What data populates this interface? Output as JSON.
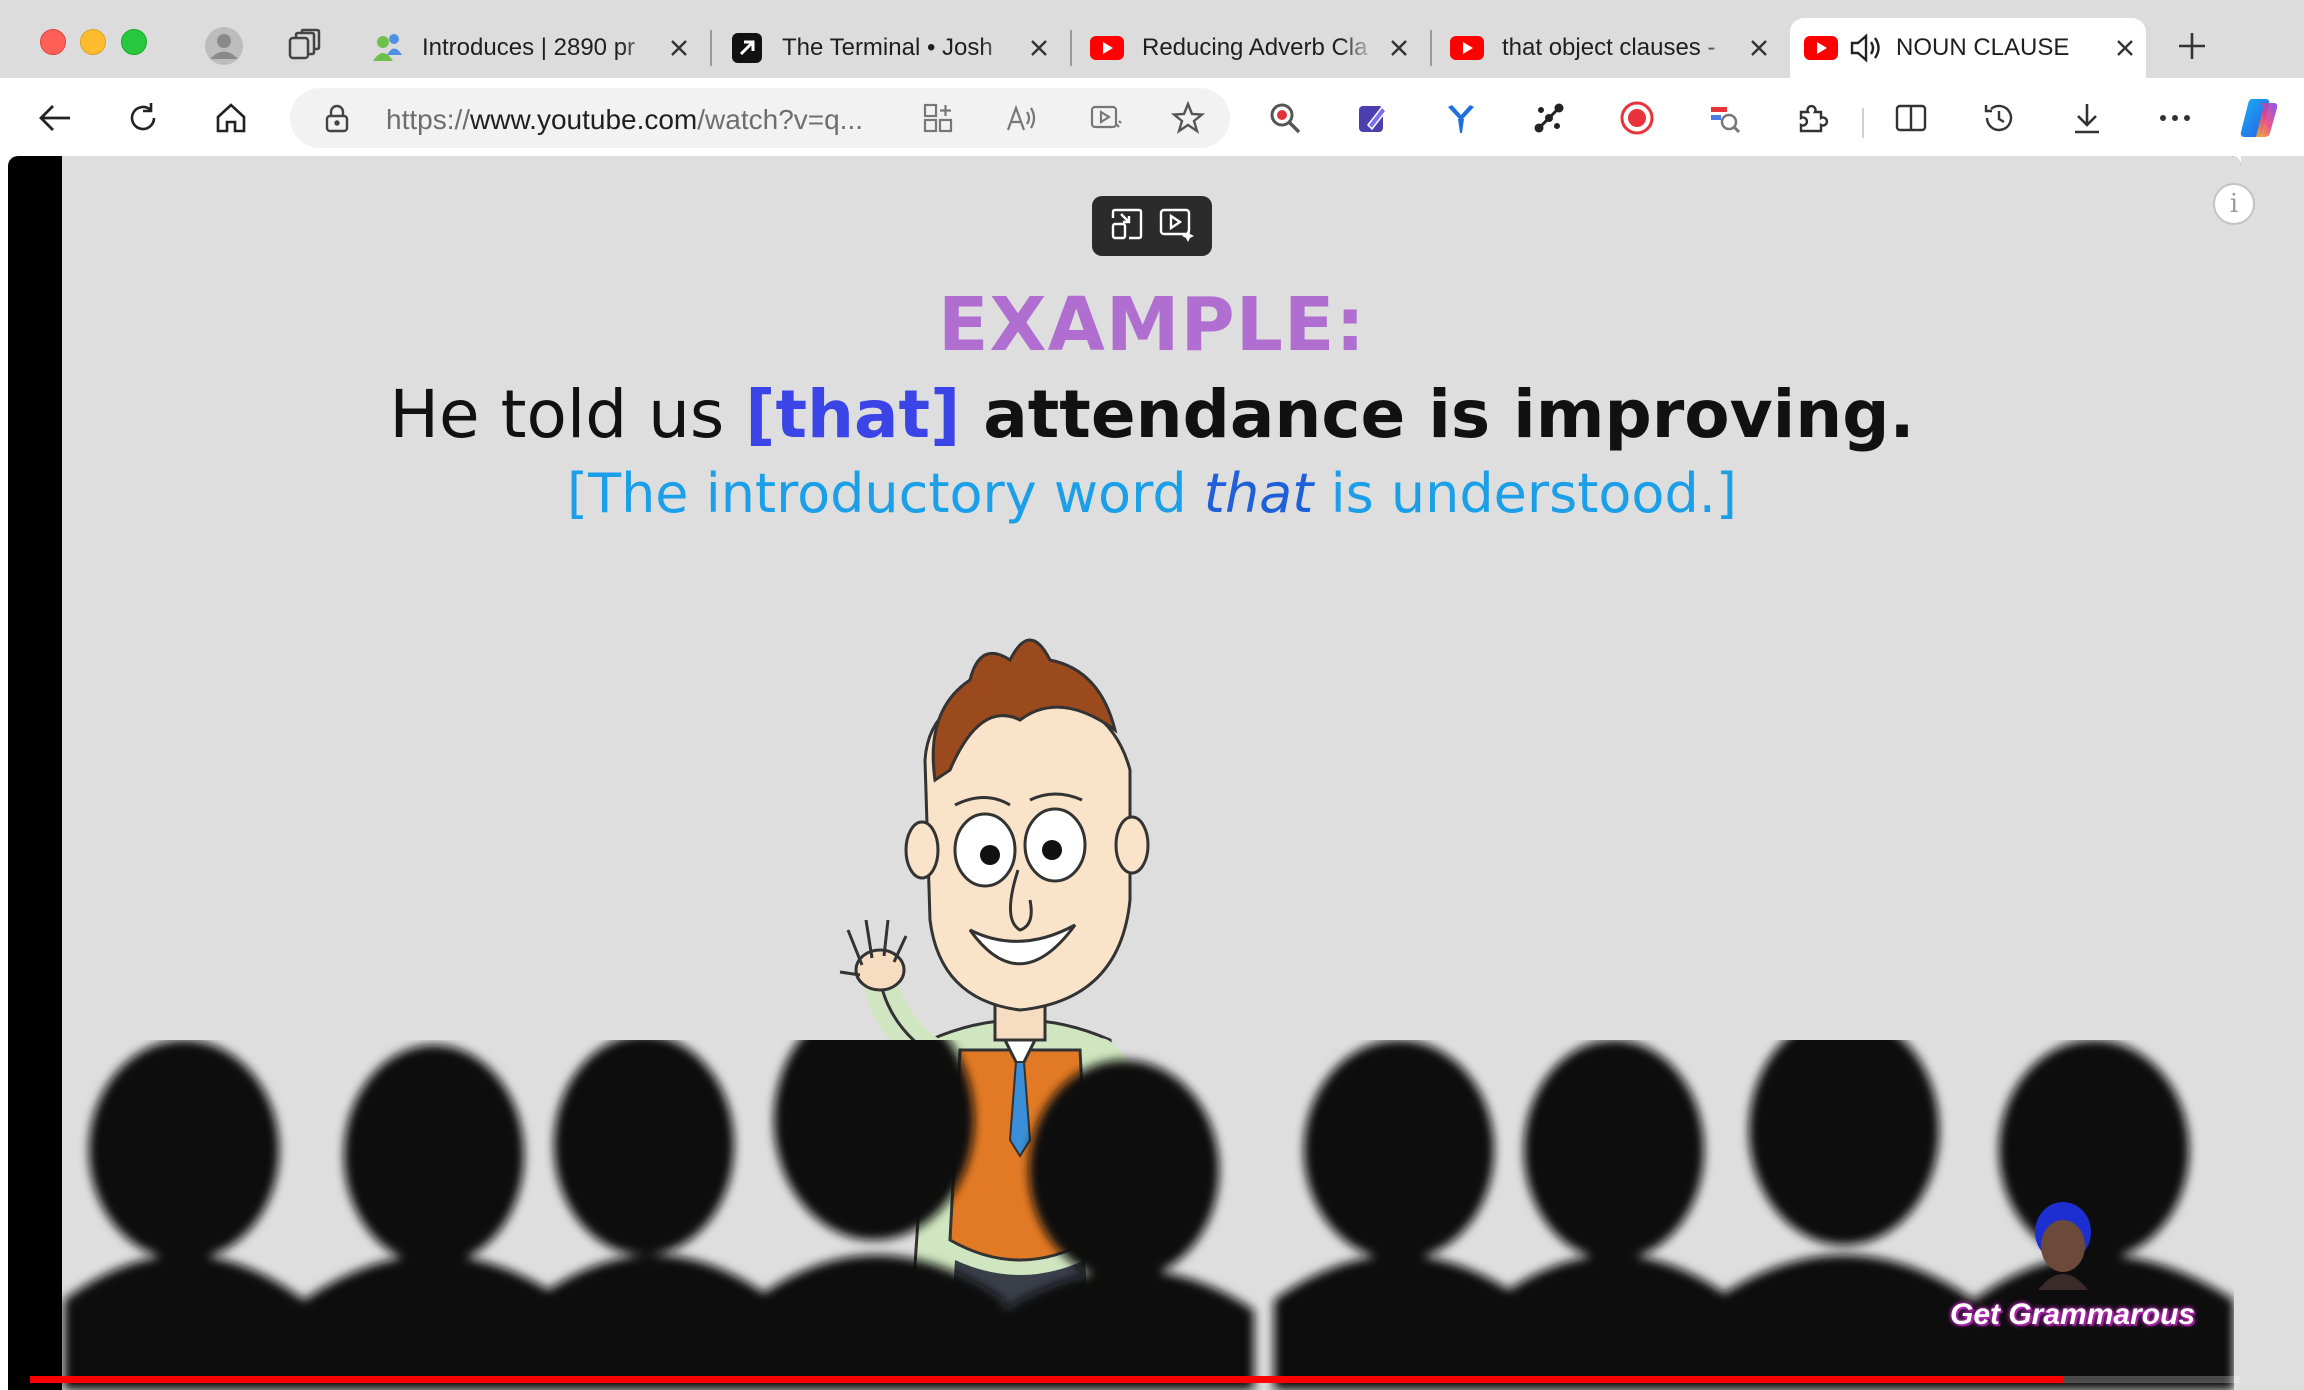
{
  "tabs": [
    {
      "title": "Introduces | 2890 pr",
      "icon": "people-icon",
      "active": false
    },
    {
      "title": "The Terminal • Josh",
      "icon": "terminal-arrow-icon",
      "active": false
    },
    {
      "title": "Reducing Adverb Cla",
      "icon": "youtube-icon",
      "active": false
    },
    {
      "title": "that object clauses -",
      "icon": "youtube-icon",
      "active": false
    },
    {
      "title": "NOUN CLAUSE",
      "icon": "youtube-icon",
      "active": true,
      "audio": "speaker-icon"
    }
  ],
  "address_bar": {
    "scheme": "https://",
    "host": "www.youtube.com",
    "path": "/watch?v=q..."
  },
  "video": {
    "heading": "EXAMPLE:",
    "sentence": {
      "part1": "He told us ",
      "that": "[that]",
      "part2": " attendance is improving."
    },
    "note": {
      "part1": "[The introductory word ",
      "em": "that",
      "part2": " is understood.]"
    },
    "watermark": "Get Grammarous",
    "progress": 0.92
  },
  "colors": {
    "heading": "#b06fd0",
    "that_word": "#3b44e6",
    "note": "#1b9fe8",
    "progress": "#ff0000"
  }
}
